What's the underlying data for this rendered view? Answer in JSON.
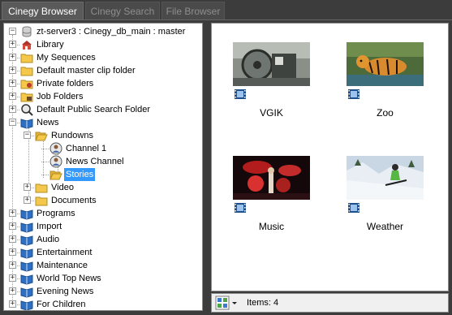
{
  "tabs": [
    {
      "label": "Cinegy Browser",
      "active": true
    },
    {
      "label": "Cinegy Search",
      "active": false
    },
    {
      "label": "File Browser",
      "active": false
    }
  ],
  "tree": {
    "root": "zt-server3 : Cinegy_db_main : master",
    "items": [
      {
        "label": "Library",
        "icon": "library-icon"
      },
      {
        "label": "My Sequences",
        "icon": "folder-icon"
      },
      {
        "label": "Default master clip folder",
        "icon": "folder-icon"
      },
      {
        "label": "Private folders",
        "icon": "private-folder-icon"
      },
      {
        "label": "Job Folders",
        "icon": "job-folder-icon"
      },
      {
        "label": "Default Public Search Folder",
        "icon": "search-folder-icon"
      },
      {
        "label": "News",
        "icon": "book-icon"
      },
      {
        "label": "Rundowns",
        "icon": "folder-open-icon"
      },
      {
        "label": "Channel 1",
        "icon": "channel-icon"
      },
      {
        "label": "News Channel",
        "icon": "channel-icon"
      },
      {
        "label": "Stories",
        "icon": "folder-open-icon"
      },
      {
        "label": "Video",
        "icon": "folder-icon"
      },
      {
        "label": "Documents",
        "icon": "folder-icon"
      },
      {
        "label": "Programs",
        "icon": "book-icon"
      },
      {
        "label": "Import",
        "icon": "book-icon"
      },
      {
        "label": "Audio",
        "icon": "book-icon"
      },
      {
        "label": "Entertainment",
        "icon": "book-icon"
      },
      {
        "label": "Maintenance",
        "icon": "book-icon"
      },
      {
        "label": "World Top News",
        "icon": "book-icon"
      },
      {
        "label": "Evening News",
        "icon": "book-icon"
      },
      {
        "label": "For Children",
        "icon": "book-icon"
      }
    ],
    "selected": "Stories"
  },
  "clips": [
    {
      "name": "VGIK",
      "icon": "film-strip-icon"
    },
    {
      "name": "Zoo",
      "icon": "film-strip-icon"
    },
    {
      "name": "Music",
      "icon": "film-strip-icon"
    },
    {
      "name": "Weather",
      "icon": "film-strip-icon"
    }
  ],
  "status": {
    "items_label": "Items: 4",
    "view_mode_icon": "thumbnail-view-icon"
  },
  "colors": {
    "selection": "#3399ff",
    "background": "#3c3c3c",
    "book_blue": "#2f6fc2",
    "folder_yellow": "#f3c84b"
  }
}
